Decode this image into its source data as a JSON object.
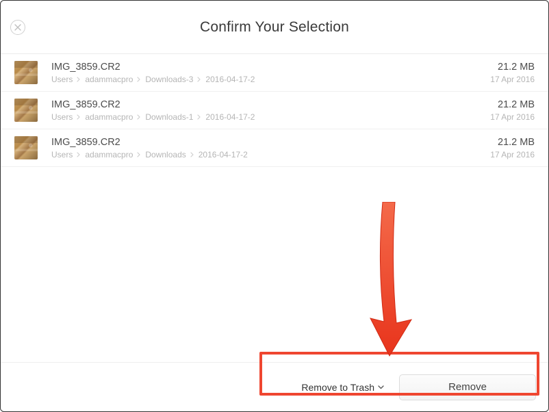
{
  "header": {
    "title": "Confirm Your Selection"
  },
  "files": [
    {
      "filename": "IMG_3859.CR2",
      "path": [
        "Users",
        "adammacpro",
        "Downloads-3",
        "2016-04-17-2"
      ],
      "size": "21.2 MB",
      "date": "17 Apr 2016"
    },
    {
      "filename": "IMG_3859.CR2",
      "path": [
        "Users",
        "adammacpro",
        "Downloads-1",
        "2016-04-17-2"
      ],
      "size": "21.2 MB",
      "date": "17 Apr 2016"
    },
    {
      "filename": "IMG_3859.CR2",
      "path": [
        "Users",
        "adammacpro",
        "Downloads",
        "2016-04-17-2"
      ],
      "size": "21.2 MB",
      "date": "17 Apr 2016"
    }
  ],
  "footer": {
    "dropdown_label": "Remove to Trash",
    "remove_label": "Remove"
  },
  "annotation": {
    "highlight_color": "#ef4630"
  }
}
